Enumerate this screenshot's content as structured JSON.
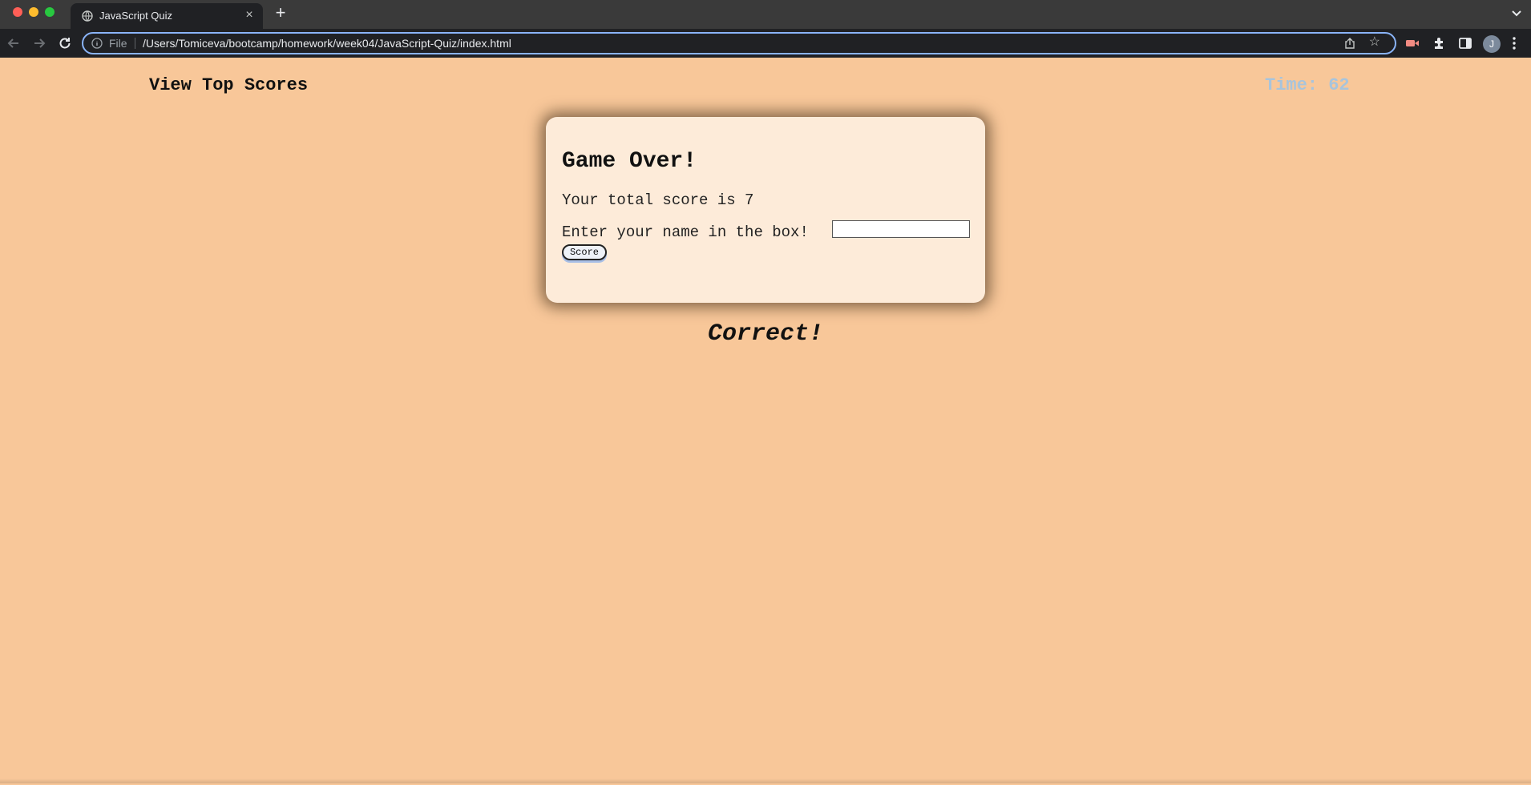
{
  "browser": {
    "tab_title": "JavaScript Quiz",
    "tab_close": "×",
    "new_tab": "+",
    "file_label": "File",
    "url": "/Users/Tomiceva/bootcamp/homework/week04/JavaScript-Quiz/index.html",
    "profile_initial": "J",
    "accent": "#8ab4f8"
  },
  "page": {
    "view_scores": "View Top Scores",
    "timer": "Time: 62",
    "background": "#f8c799",
    "timer_color": "#a8c4dc"
  },
  "card": {
    "title": "Game Over!",
    "score_text": "Your total score is 7",
    "name_prompt": "Enter your name in the box!",
    "name_value": "",
    "button_label": "Score"
  },
  "feedback": "Correct!"
}
